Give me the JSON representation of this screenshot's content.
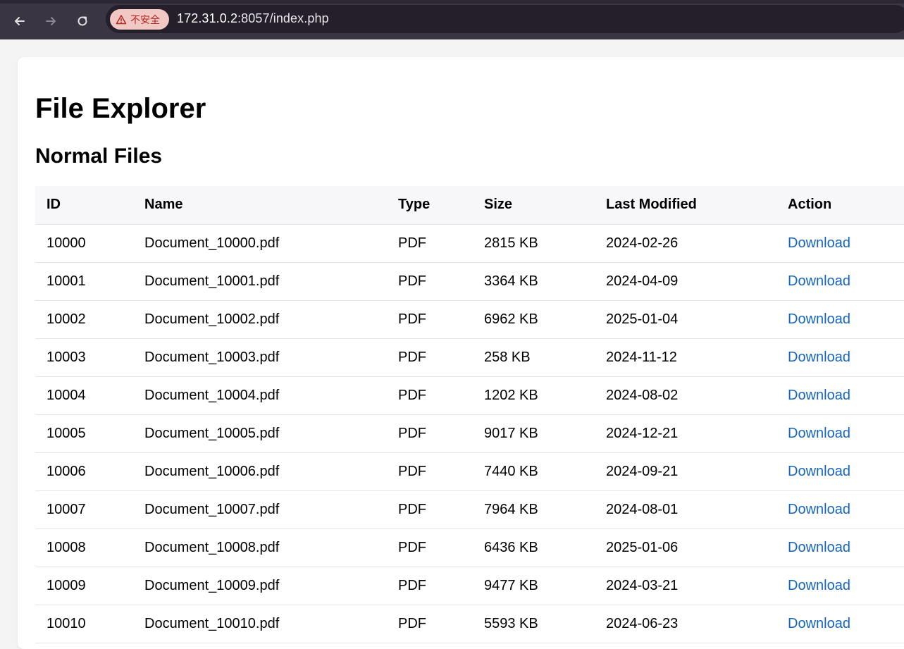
{
  "browser": {
    "security_label": "不安全",
    "url_host": "172.31.0.2",
    "url_rest": ":8057/index.php"
  },
  "page": {
    "title": "File Explorer",
    "section_title": "Normal Files"
  },
  "table": {
    "headers": [
      "ID",
      "Name",
      "Type",
      "Size",
      "Last Modified",
      "Action"
    ],
    "rows": [
      {
        "id": "10000",
        "name": "Document_10000.pdf",
        "type": "PDF",
        "size": "2815 KB",
        "modified": "2024-02-26",
        "action": "Download"
      },
      {
        "id": "10001",
        "name": "Document_10001.pdf",
        "type": "PDF",
        "size": "3364 KB",
        "modified": "2024-04-09",
        "action": "Download"
      },
      {
        "id": "10002",
        "name": "Document_10002.pdf",
        "type": "PDF",
        "size": "6962 KB",
        "modified": "2025-01-04",
        "action": "Download"
      },
      {
        "id": "10003",
        "name": "Document_10003.pdf",
        "type": "PDF",
        "size": "258 KB",
        "modified": "2024-11-12",
        "action": "Download"
      },
      {
        "id": "10004",
        "name": "Document_10004.pdf",
        "type": "PDF",
        "size": "1202 KB",
        "modified": "2024-08-02",
        "action": "Download"
      },
      {
        "id": "10005",
        "name": "Document_10005.pdf",
        "type": "PDF",
        "size": "9017 KB",
        "modified": "2024-12-21",
        "action": "Download"
      },
      {
        "id": "10006",
        "name": "Document_10006.pdf",
        "type": "PDF",
        "size": "7440 KB",
        "modified": "2024-09-21",
        "action": "Download"
      },
      {
        "id": "10007",
        "name": "Document_10007.pdf",
        "type": "PDF",
        "size": "7964 KB",
        "modified": "2024-08-01",
        "action": "Download"
      },
      {
        "id": "10008",
        "name": "Document_10008.pdf",
        "type": "PDF",
        "size": "6436 KB",
        "modified": "2025-01-06",
        "action": "Download"
      },
      {
        "id": "10009",
        "name": "Document_10009.pdf",
        "type": "PDF",
        "size": "9477 KB",
        "modified": "2024-03-21",
        "action": "Download"
      },
      {
        "id": "10010",
        "name": "Document_10010.pdf",
        "type": "PDF",
        "size": "5593 KB",
        "modified": "2024-06-23",
        "action": "Download"
      }
    ]
  },
  "colors": {
    "link": "#1565c0",
    "chrome_bg": "#3a3543",
    "omnibox_bg": "#241f2a",
    "security_chip_bg": "#f2c8c4",
    "security_text": "#b3261e"
  },
  "icons": [
    "back-arrow-icon",
    "forward-arrow-icon",
    "reload-icon",
    "warning-triangle-icon"
  ]
}
